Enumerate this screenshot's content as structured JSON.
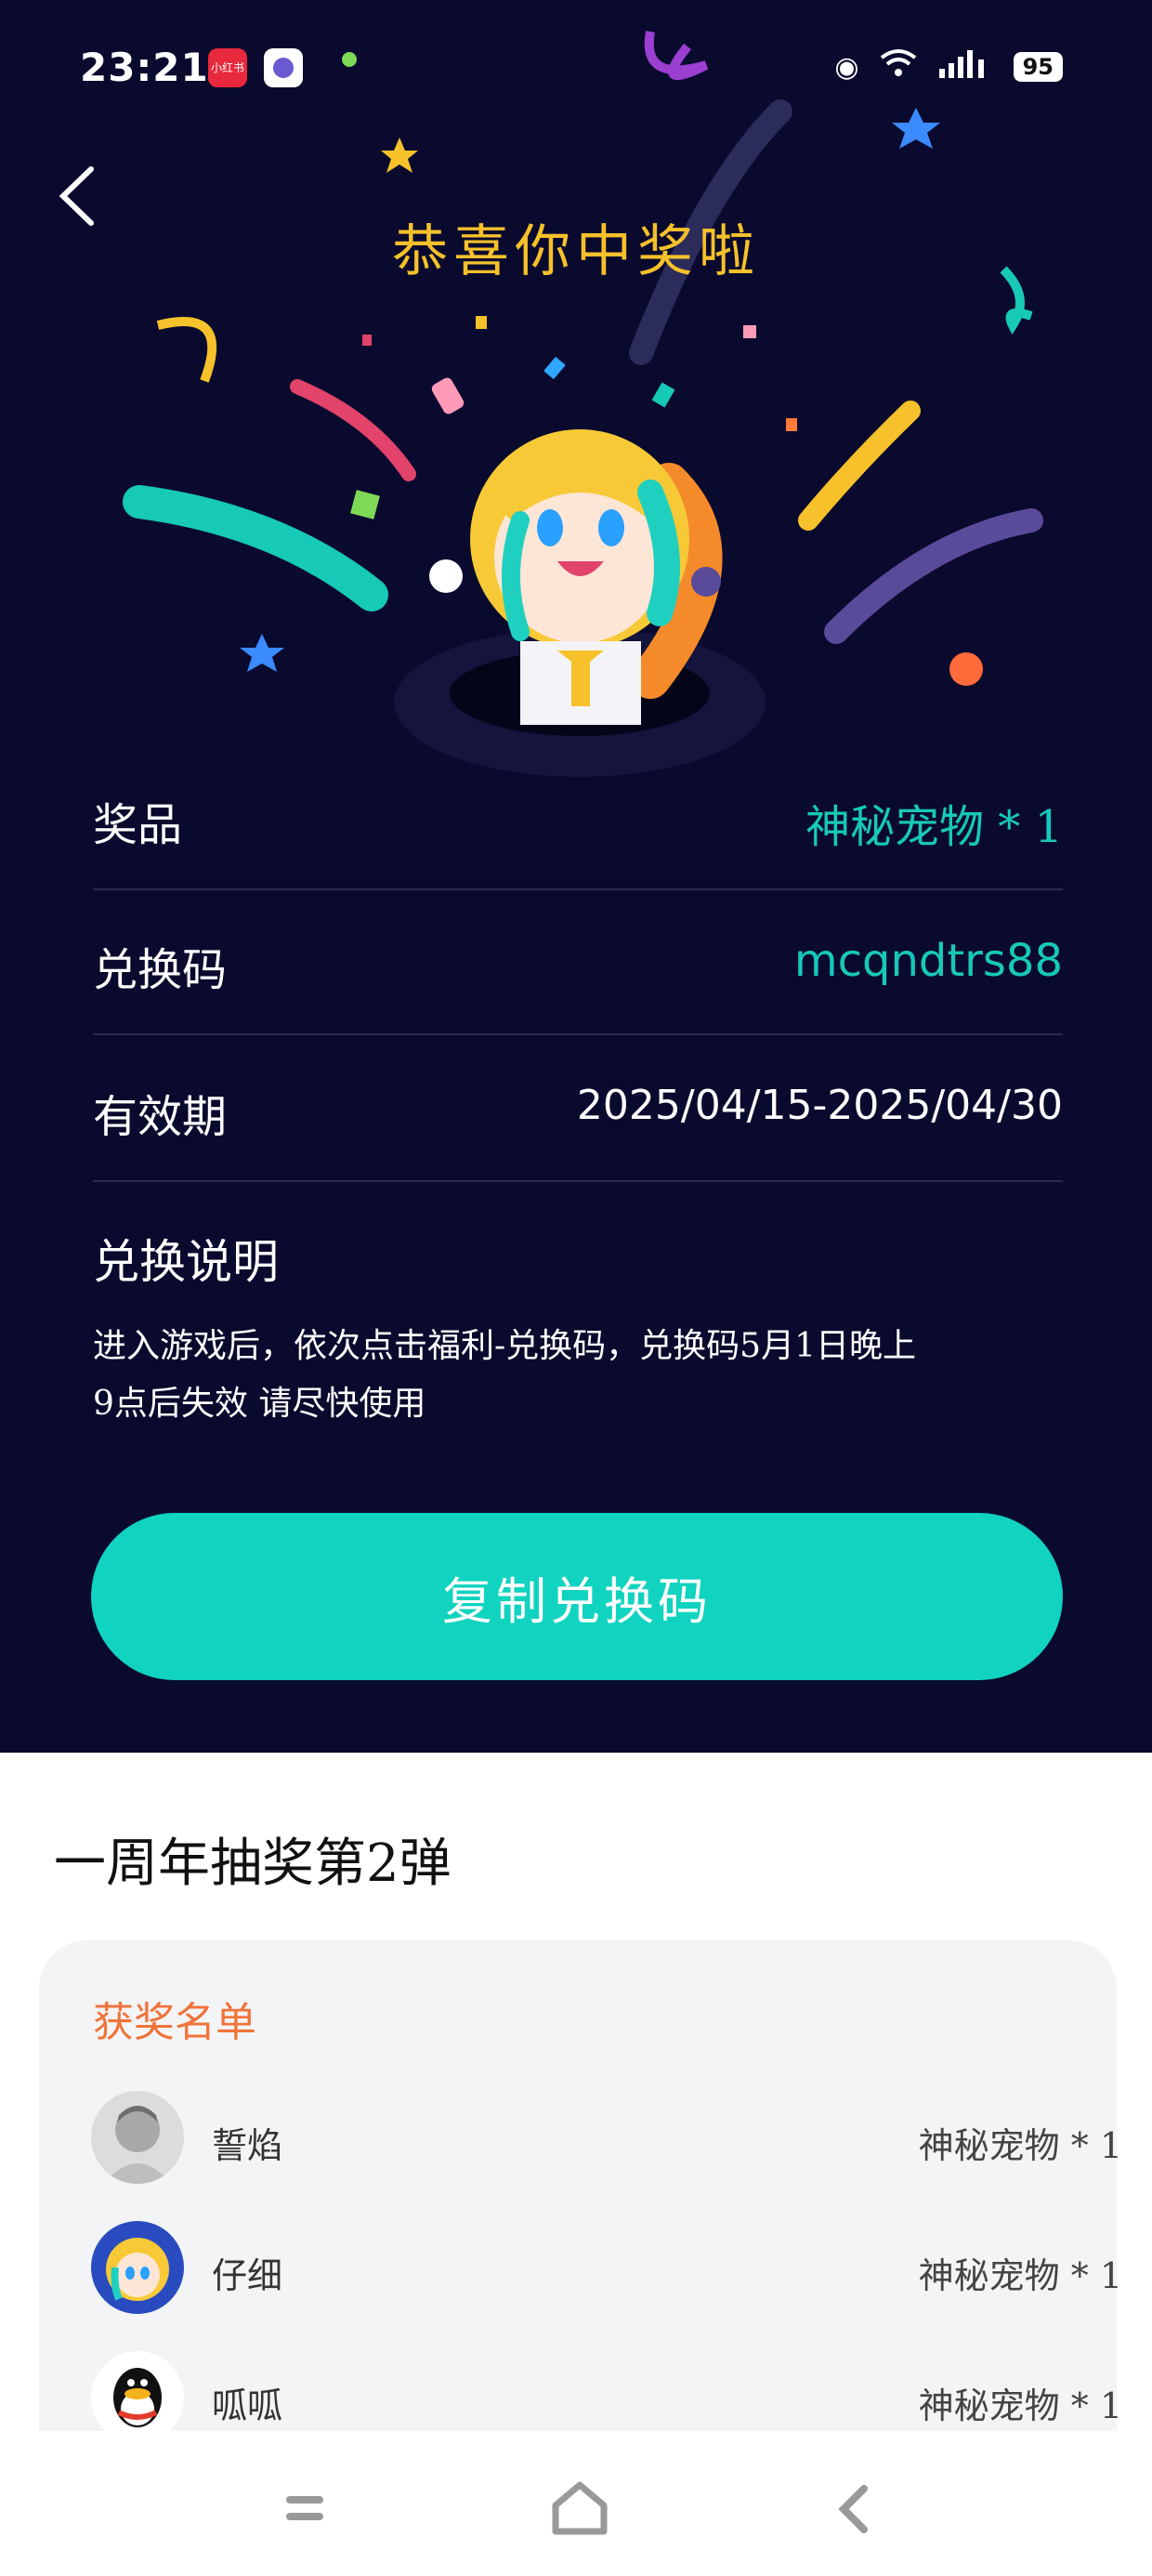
{
  "status": {
    "time": "23:21",
    "app1_label": "小红书",
    "battery": "95"
  },
  "header": {
    "title": "恭喜你中奖啦"
  },
  "prize": {
    "prize_label": "奖品",
    "prize_value": "神秘宠物 * 1",
    "code_label": "兑换码",
    "code_value": "mcqndtrs88",
    "valid_label": "有效期",
    "valid_value": "2025/04/15-2025/04/30"
  },
  "instructions": {
    "title": "兑换说明",
    "body_line1": "进入游戏后，依次点击福利-兑换码，兑换码5月1日晚上",
    "body_line2": "9点后失效 请尽快使用"
  },
  "copy_button": {
    "label": "复制兑换码"
  },
  "event": {
    "title": "一周年抽奖第2弹",
    "list_title": "获奖名单"
  },
  "winners": [
    {
      "name": "誓焰",
      "prize": "神秘宠物 * 1"
    },
    {
      "name": "仔细",
      "prize": "神秘宠物 * 1"
    },
    {
      "name": "呱呱",
      "prize": "神秘宠物 * 1"
    }
  ],
  "colors": {
    "background": "#0a0a2e",
    "accent": "#10d3c0",
    "title": "#f6c12a",
    "list_title": "#f0733a"
  }
}
